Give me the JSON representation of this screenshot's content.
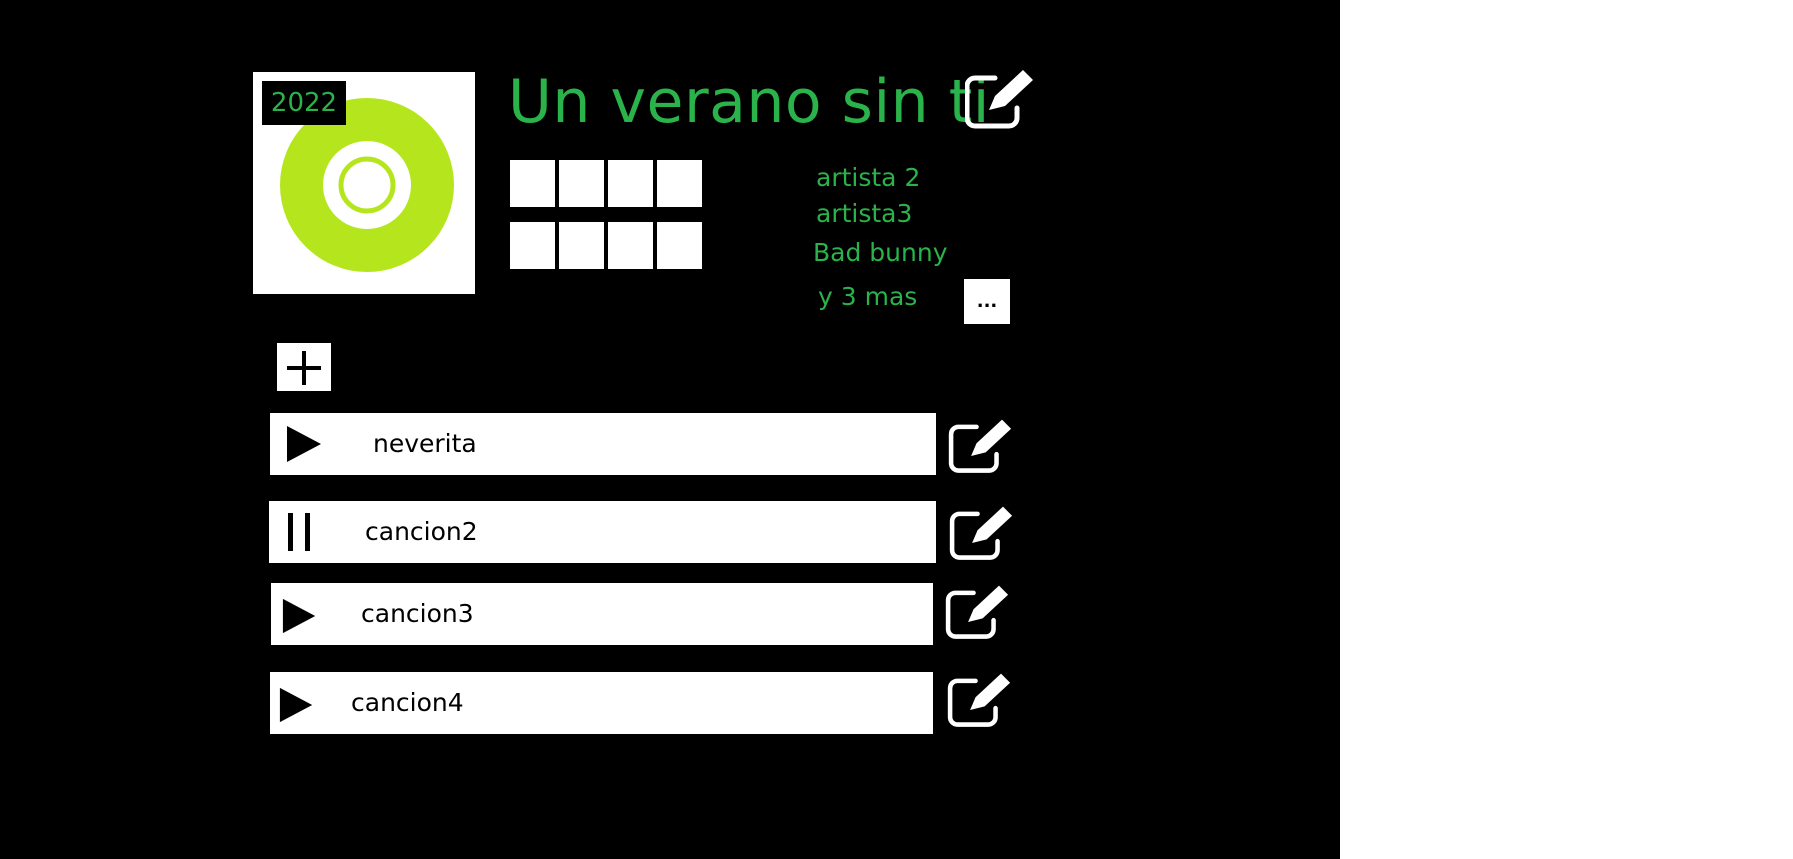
{
  "colors": {
    "background": "#000000",
    "surface": "#ffffff",
    "accent_green": "#2ab34a",
    "disc_green": "#b5e61d"
  },
  "album": {
    "year": "2022",
    "title": "Un verano sin ti",
    "cover_icon": "disc-icon",
    "artists": [
      "artista 2",
      "artista3",
      "Bad bunny",
      "y 3 mas"
    ],
    "more_button_label": "..."
  },
  "rating": {
    "rows": 2,
    "columns": 4
  },
  "songs": [
    {
      "title": "neverita",
      "state_icon": "play-icon"
    },
    {
      "title": "cancion2",
      "state_icon": "pause-icon"
    },
    {
      "title": "cancion3",
      "state_icon": "play-icon"
    },
    {
      "title": "cancion4",
      "state_icon": "play-icon"
    }
  ],
  "icons": {
    "edit": "edit-icon",
    "add": "plus-icon"
  }
}
